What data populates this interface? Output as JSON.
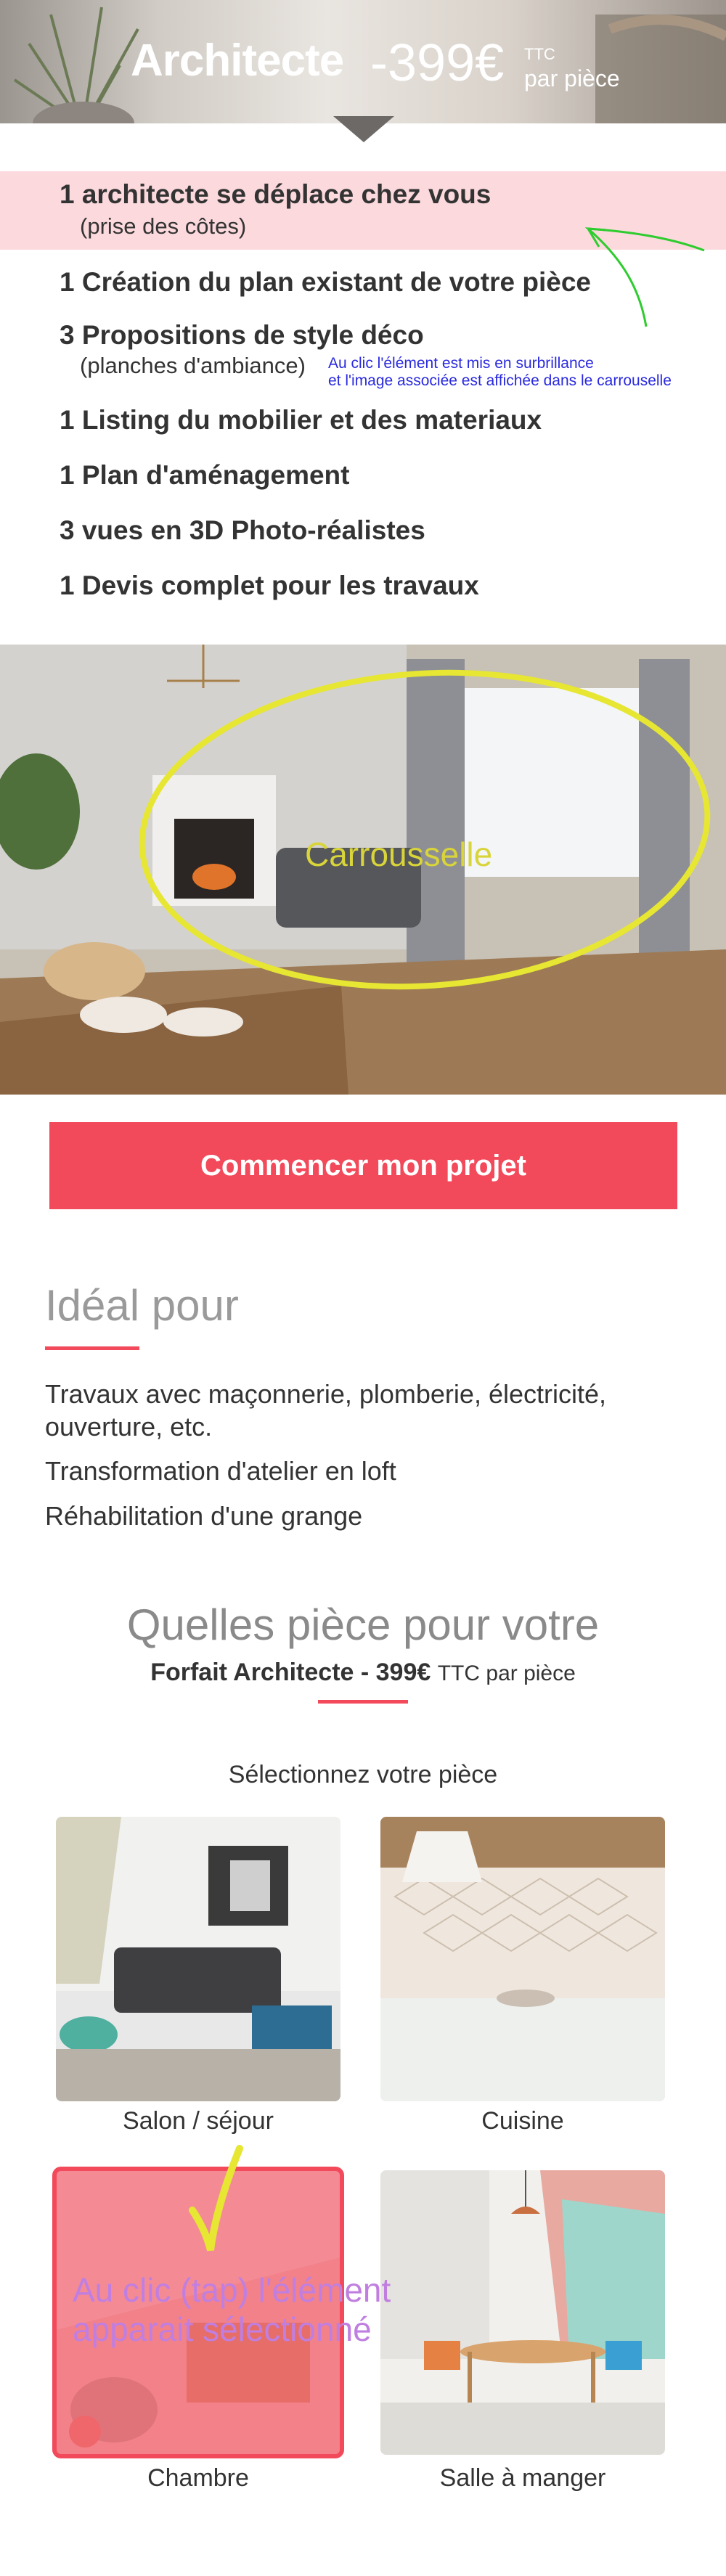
{
  "header": {
    "title": "Architecte",
    "price": "-399€",
    "ttc": "TTC",
    "per_piece": "par pièce"
  },
  "features": [
    {
      "label": "1 architecte se déplace chez vous",
      "sub": "(prise des côtes)",
      "highlighted": true
    },
    {
      "label": "1 Création du plan existant de votre pièce"
    },
    {
      "label": "3 Propositions de style déco",
      "sub": "(planches d'ambiance)"
    },
    {
      "label": "1 Listing du mobilier et des materiaux"
    },
    {
      "label": "1 Plan d'aménagement"
    },
    {
      "label": "3 vues en 3D Photo-réalistes"
    },
    {
      "label": "1 Devis complet pour les travaux"
    }
  ],
  "annotations": {
    "list_note_line1": "Au clic l'élément est mis en surbrillance",
    "list_note_line2": "et l'image associée est affichée dans le carrouselle",
    "carousel_label": "Carrousselle",
    "card_note_line1": "Au clic (tap) l'élément",
    "card_note_line2": "apparait sélectionné"
  },
  "cta": {
    "label": "Commencer mon projet"
  },
  "ideal": {
    "title": "Idéal pour",
    "items": [
      "Travaux avec maçonnerie, plomberie, électricité,",
      "ouverture, etc.",
      "Transformation d'atelier en loft",
      "Réhabilitation d'une grange"
    ]
  },
  "rooms_section": {
    "title": "Quelles pièce pour votre",
    "subtitle_bold": "Forfait Architecte - 399€",
    "subtitle_small": "TTC par pièce",
    "select_label": "Sélectionnez votre pièce",
    "rooms": [
      {
        "label": "Salon / séjour",
        "selected": false
      },
      {
        "label": "Cuisine",
        "selected": false
      },
      {
        "label": "Chambre",
        "selected": true
      },
      {
        "label": "Salle à manger",
        "selected": false
      }
    ]
  },
  "colors": {
    "accent": "#f2495b",
    "highlight": "#fbd9dd",
    "annotation_blue": "#2a2adf",
    "annotation_green": "#2ecc2e",
    "annotation_yellow": "#e6e633",
    "annotation_purple": "#b66fd6"
  }
}
